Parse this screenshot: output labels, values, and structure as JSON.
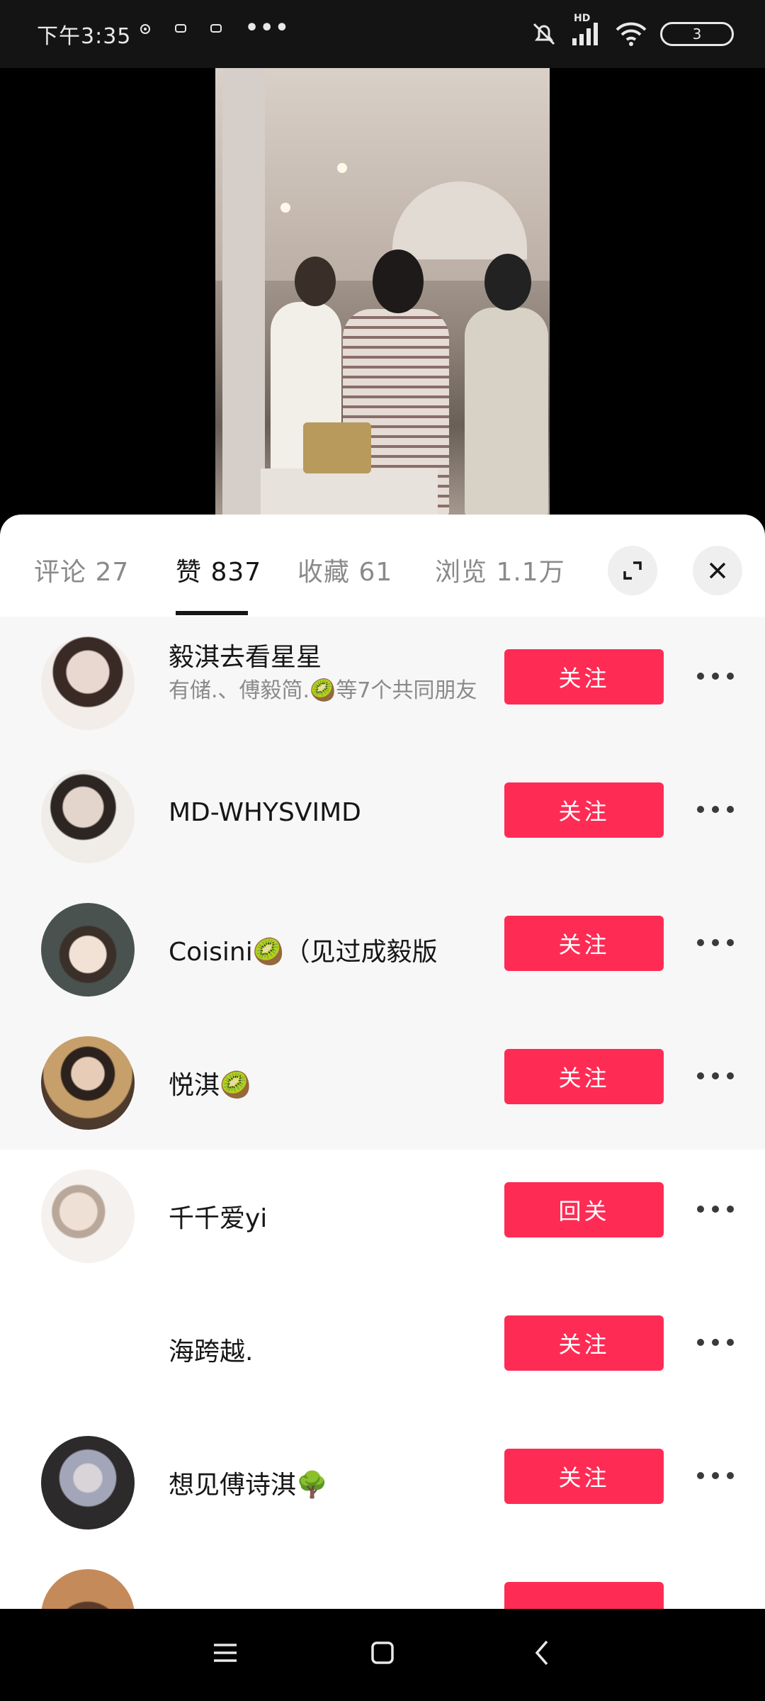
{
  "status_bar": {
    "time": "下午3:35",
    "network": "HD",
    "battery": "3"
  },
  "tabs": [
    {
      "label": "评论 27"
    },
    {
      "label": "赞 837"
    },
    {
      "label": "收藏 61"
    },
    {
      "label": "浏览 1.1万"
    }
  ],
  "users": [
    {
      "name": "毅淇去看星星",
      "sub": "有储.、傅毅简.🥝等7个共同朋友",
      "button": "关注"
    },
    {
      "name": "MD-WHYSVIMD",
      "button": "关注"
    },
    {
      "name": "Coisini🥝（见过成毅版",
      "button": "关注"
    },
    {
      "name": "悦淇🥝",
      "button": "关注"
    },
    {
      "name": "千千爱yi",
      "button": "回关"
    },
    {
      "name": "海跨越.",
      "button": "关注"
    },
    {
      "name": "想见傅诗淇🌳",
      "button": "关注"
    },
    {
      "name": "",
      "button": ""
    }
  ],
  "colors": {
    "accent": "#fe2c55"
  }
}
